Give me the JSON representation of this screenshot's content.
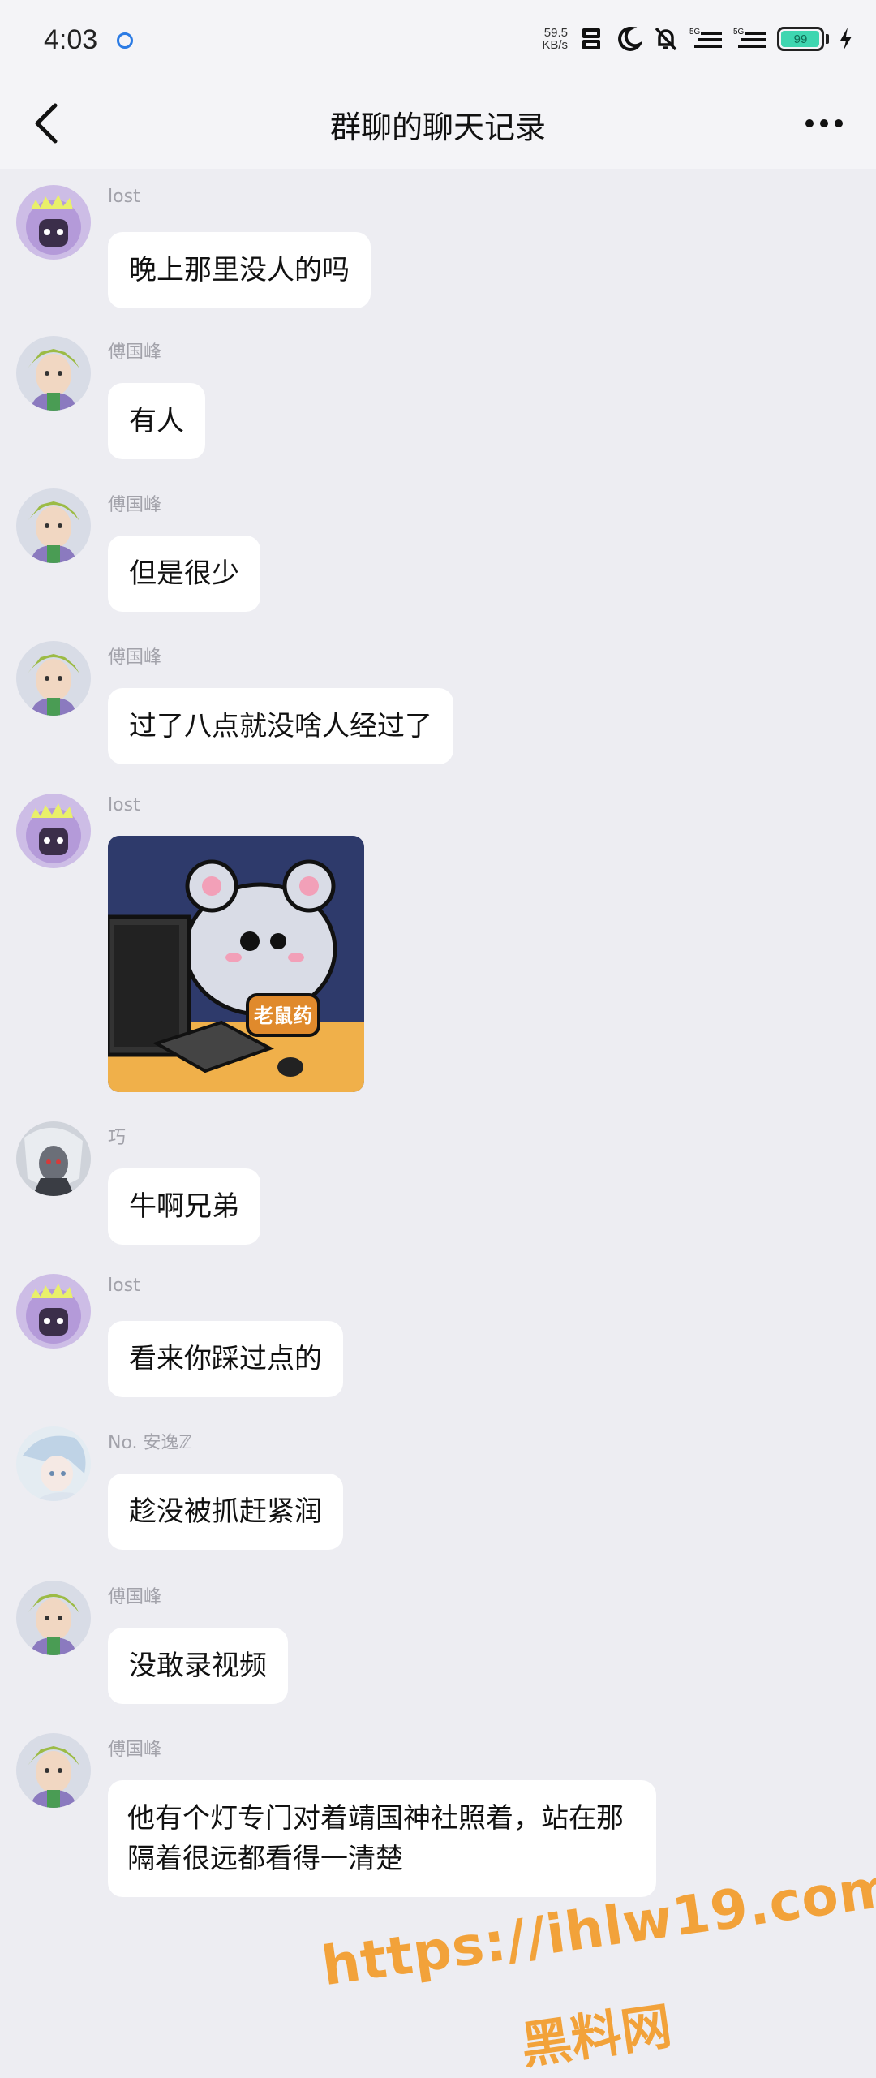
{
  "status_bar": {
    "time": "4:03",
    "net_speed_value": "59.5",
    "net_speed_unit": "KB/s",
    "signal_1_label": "5G",
    "signal_2_label": "5G",
    "battery_level": "99"
  },
  "header": {
    "title": "群聊的聊天记录"
  },
  "messages": [
    {
      "sender": "lost",
      "text": "晚上那里没人的吗"
    },
    {
      "sender": "傅国峰",
      "text": "有人"
    },
    {
      "sender": "傅国峰",
      "text": "但是很少"
    },
    {
      "sender": "傅国峰",
      "text": "过了八点就没啥人经过了"
    },
    {
      "sender": "lost",
      "sticker_caption": "老鼠药"
    },
    {
      "sender": "巧",
      "text": "牛啊兄弟"
    },
    {
      "sender": "lost",
      "text": "看来你踩过点的"
    },
    {
      "sender": "No. 安逸ℤ",
      "text": "趁没被抓赶紧润"
    },
    {
      "sender": "傅国峰",
      "text": "没敢录视频"
    },
    {
      "sender": "傅国峰",
      "text": "他有个灯专门对着靖国神社照着，站在那隔着很远都看得一清楚"
    }
  ],
  "watermark": {
    "url": "https://ihlw19.com",
    "site": "黑料网"
  },
  "colors": {
    "background": "#EDEDF2",
    "bubble": "#FFFFFF",
    "sender_name": "#A2A2AA",
    "battery_fill": "#3ED6B0",
    "watermark": "#F2A23A"
  },
  "icons": [
    "back-arrow-icon",
    "more-dots-icon",
    "nfc-icon",
    "moon-icon",
    "bell-off-icon",
    "signal-icon",
    "battery-icon",
    "charging-icon"
  ]
}
